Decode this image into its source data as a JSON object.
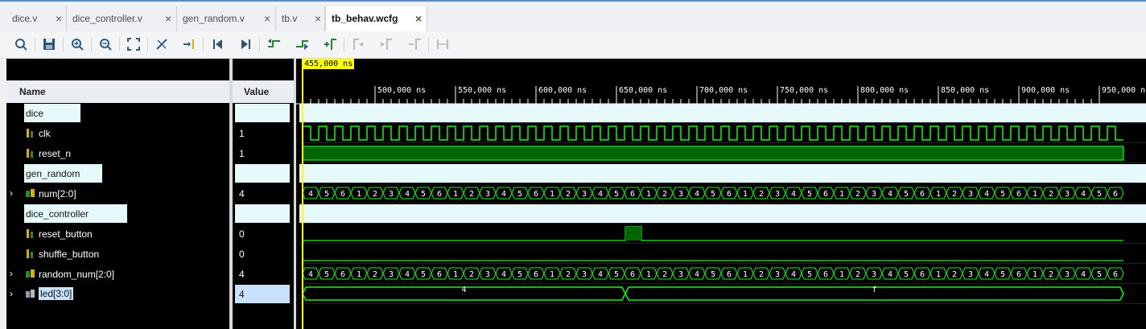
{
  "tabs": [
    {
      "label": "dice.v",
      "active": false
    },
    {
      "label": "dice_controller.v",
      "active": false
    },
    {
      "label": "gen_random.v",
      "active": false
    },
    {
      "label": "tb.v",
      "active": false
    },
    {
      "label": "tb_behav.wcfg",
      "active": true
    }
  ],
  "tab_close_glyph": "×",
  "toolbar": [
    "search-icon",
    "save-icon",
    "zoom-in-icon",
    "zoom-out-icon",
    "zoom-fit-icon",
    "swap-cursor-icon",
    "go-to-cursor-icon",
    "go-to-start-icon",
    "go-to-end-icon",
    "previous-transition-icon",
    "next-transition-icon",
    "add-marker-icon",
    "previous-marker-icon",
    "next-marker-icon",
    "delete-marker-icon",
    "marker-range-icon"
  ],
  "columns": {
    "name": "Name",
    "value": "Value"
  },
  "cursor": {
    "label": "455,000 ns"
  },
  "timeline": {
    "ticks": [
      "500,000 ns",
      "550,000 ns",
      "600,000 ns",
      "650,000 ns",
      "700,000 ns",
      "750,000 ns",
      "800,000 ns",
      "850,000 ns",
      "900,000 ns",
      "950,000 ns"
    ]
  },
  "signals": [
    {
      "name": "dice",
      "kind": "group",
      "value": ""
    },
    {
      "name": "clk",
      "kind": "bit",
      "value": "1"
    },
    {
      "name": "reset_n",
      "kind": "bit",
      "value": "1"
    },
    {
      "name": "gen_random",
      "kind": "group",
      "value": ""
    },
    {
      "name": "num[2:0]",
      "kind": "bus",
      "value": "4"
    },
    {
      "name": "dice_controller",
      "kind": "group",
      "value": ""
    },
    {
      "name": "reset_button",
      "kind": "bit",
      "value": "0"
    },
    {
      "name": "shuffle_button",
      "kind": "bit",
      "value": "0"
    },
    {
      "name": "random_num[2:0]",
      "kind": "bus",
      "value": "4"
    },
    {
      "name": "led[3:0]",
      "kind": "bus",
      "value": "4",
      "selected": true
    }
  ],
  "waves": {
    "bus_sequence": [
      "4",
      "5",
      "6",
      "1",
      "2",
      "3",
      "4",
      "5",
      "6",
      "1",
      "2",
      "3",
      "4",
      "5",
      "6",
      "1",
      "2",
      "3",
      "4",
      "5",
      "6",
      "1",
      "2",
      "3",
      "4",
      "5",
      "6",
      "1",
      "2",
      "3",
      "4",
      "5",
      "6",
      "1",
      "2",
      "3",
      "4",
      "5",
      "6",
      "1",
      "2",
      "3",
      "4",
      "5",
      "6",
      "1",
      "2",
      "3",
      "4",
      "5",
      "6"
    ],
    "led_segments": [
      "4",
      "f"
    ],
    "colors": {
      "signal": "#00ff00",
      "fill": "#006600",
      "group": "#e6fafc",
      "cursor": "#ffff00",
      "header": "#eaedf1"
    }
  }
}
